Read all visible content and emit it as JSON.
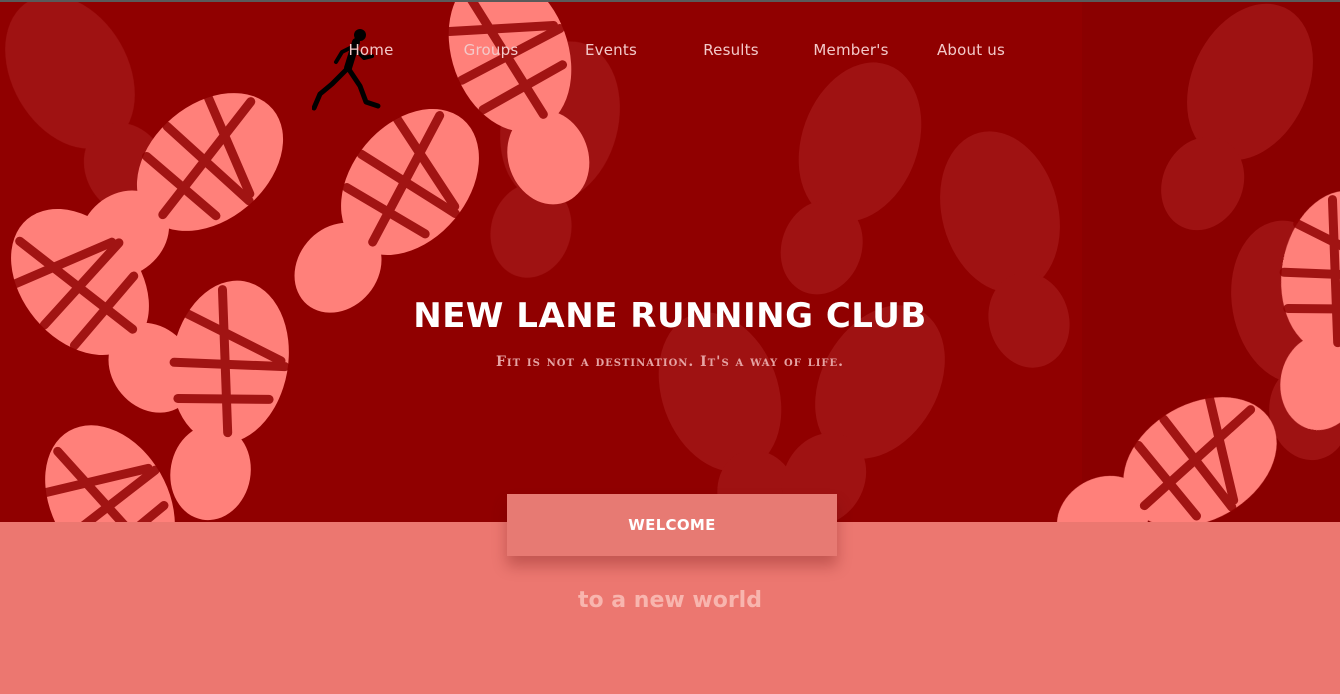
{
  "nav": {
    "items": [
      {
        "label": "Home"
      },
      {
        "label": "Groups"
      },
      {
        "label": "Events"
      },
      {
        "label": "Results"
      },
      {
        "label": "Member's"
      },
      {
        "label": "About us"
      }
    ]
  },
  "logo": {
    "icon": "runner-icon"
  },
  "hero": {
    "title": "NEW LANE RUNNING CLUB",
    "tagline": "Fit is not a destination. It's a way of life.",
    "background_icon": "shoe-print-pattern"
  },
  "welcome": {
    "label": "WELCOME",
    "subtitle": "to a new world"
  },
  "colors": {
    "hero_background": "#900000",
    "footprint": "#ff7f7a",
    "welcome_section": "#ec7770",
    "nav_text": "#f3c9c9",
    "title_text": "#ffffff"
  }
}
